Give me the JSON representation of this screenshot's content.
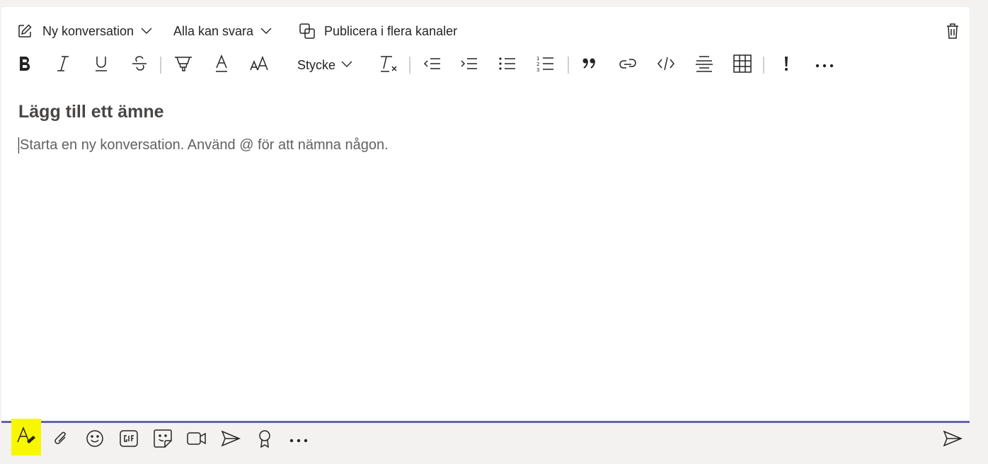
{
  "topbar": {
    "new_conversation_label": "Ny konversation",
    "reply_setting_label": "Alla kan svara",
    "publish_label": "Publicera i flera kanaler"
  },
  "format_toolbar": {
    "paragraph_style_label": "Stycke",
    "buttons": [
      "bold-icon",
      "italic-icon",
      "underline-icon",
      "strikethrough-icon",
      "highlight-icon",
      "font-color-icon",
      "font-size-icon",
      "clear-formatting-icon",
      "decrease-indent-icon",
      "increase-indent-icon",
      "bulleted-list-icon",
      "numbered-list-icon",
      "quote-icon",
      "link-icon",
      "code-snippet-icon",
      "horizontal-rule-icon",
      "table-icon",
      "important-icon",
      "more-options-icon"
    ]
  },
  "compose": {
    "subject_placeholder": "Lägg till ett ämne",
    "body_placeholder": "Starta en ny konversation. Använd @ för att nämna någon."
  },
  "bottom_toolbar": {
    "buttons": [
      "format-icon",
      "attach-icon",
      "emoji-icon",
      "gif-icon",
      "sticker-icon",
      "meet-now-icon",
      "stream-icon",
      "praise-icon",
      "more-apps-icon",
      "send-icon"
    ]
  },
  "colors": {
    "accent": "#6264a7",
    "highlight": "#f7f700",
    "background": "#f3f2f1"
  }
}
